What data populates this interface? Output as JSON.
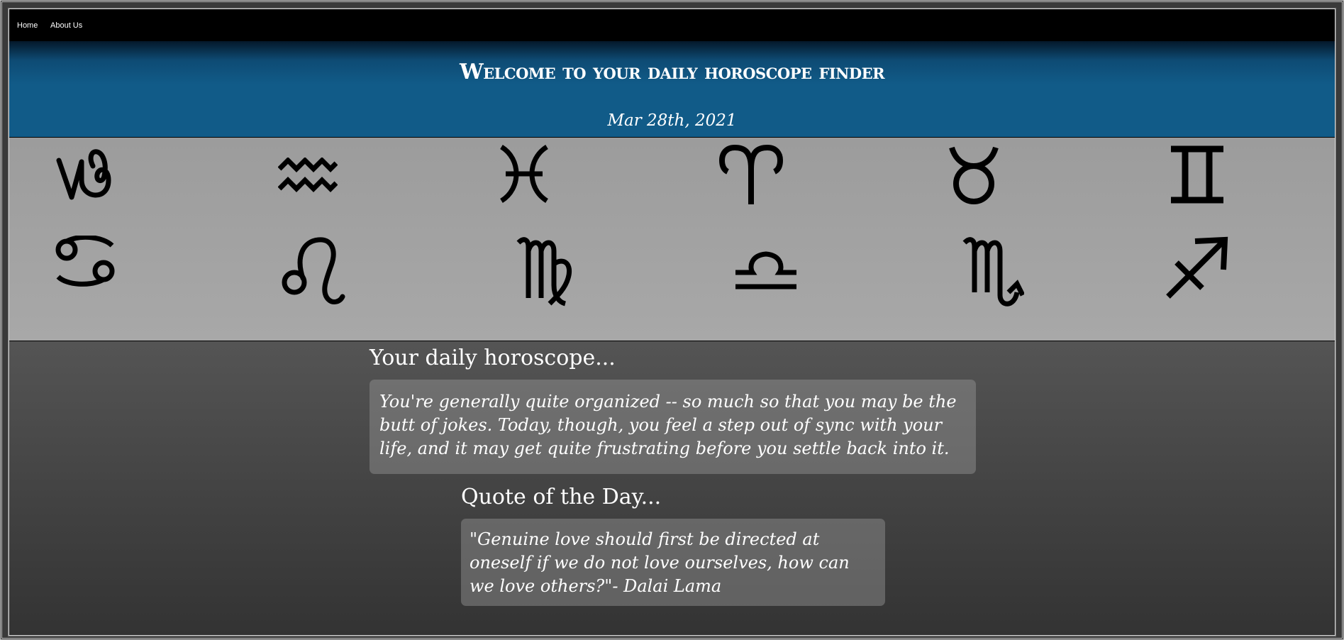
{
  "nav": {
    "home": "Home",
    "about": "About Us"
  },
  "header": {
    "title": "Welcome to your daily horoscope finder",
    "date": "Mar 28th, 2021"
  },
  "zodiac_signs": [
    {
      "name": "capricorn",
      "icon": "capricorn-icon"
    },
    {
      "name": "aquarius",
      "icon": "aquarius-icon"
    },
    {
      "name": "pisces",
      "icon": "pisces-icon"
    },
    {
      "name": "aries",
      "icon": "aries-icon"
    },
    {
      "name": "taurus",
      "icon": "taurus-icon"
    },
    {
      "name": "gemini",
      "icon": "gemini-icon"
    },
    {
      "name": "cancer",
      "icon": "cancer-icon"
    },
    {
      "name": "leo",
      "icon": "leo-icon"
    },
    {
      "name": "virgo",
      "icon": "virgo-icon"
    },
    {
      "name": "libra",
      "icon": "libra-icon"
    },
    {
      "name": "scorpio",
      "icon": "scorpio-icon"
    },
    {
      "name": "sagittarius",
      "icon": "sagittarius-icon"
    }
  ],
  "horoscope": {
    "heading": "Your daily horoscope...",
    "text": "You're generally quite organized -- so much so that you may be the butt of jokes. Today, though, you feel a step out of sync with your life, and it may get quite frustrating before you settle back into it."
  },
  "quote": {
    "heading": "Quote of the Day...",
    "text": "\"Genuine love should first be directed at oneself if we do not love ourselves, how can we love others?\"- Dalai Lama"
  },
  "colors": {
    "navbar": "#000000",
    "header_blue": "#115b88",
    "sign_strip": "#a0a0a0",
    "card": "#8c8c8c"
  }
}
